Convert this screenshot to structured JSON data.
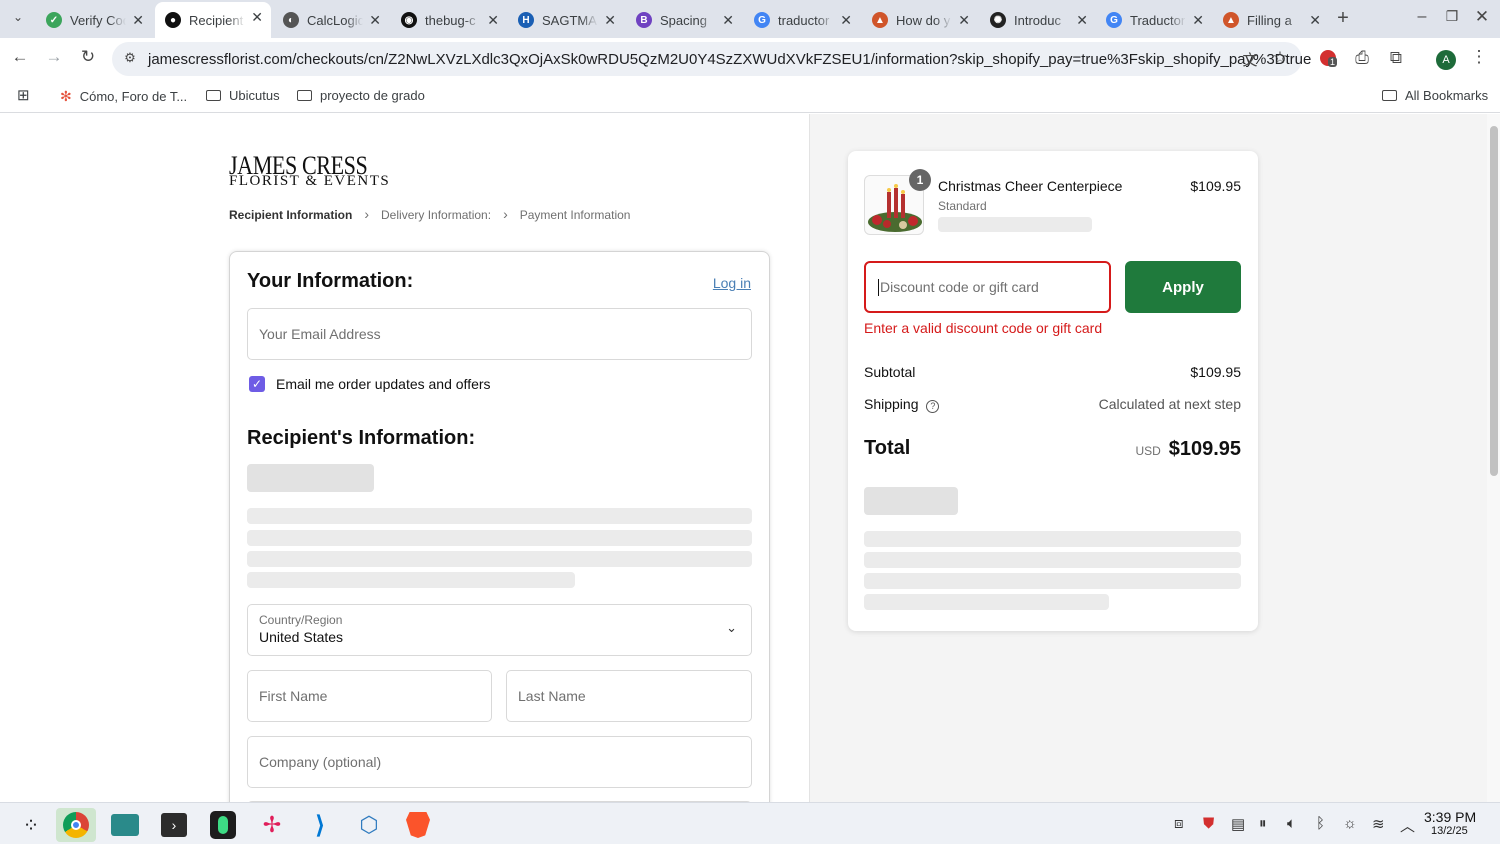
{
  "browser": {
    "tabs": [
      {
        "title": "Verify Code",
        "icon": "verify-icon",
        "color": "#3ca55c"
      },
      {
        "title": "Recipient Information",
        "icon": "shop-icon",
        "color": "#111111",
        "active": true
      },
      {
        "title": "CalcLogic",
        "icon": "calc-icon",
        "color": "#555555"
      },
      {
        "title": "thebug-c",
        "icon": "github-icon",
        "color": "#111111"
      },
      {
        "title": "SAGTMA",
        "icon": "h-icon",
        "color": "#1a5fb4"
      },
      {
        "title": "Spacing",
        "icon": "bootstrap-icon",
        "color": "#6f42c1"
      },
      {
        "title": "traductor",
        "icon": "google-icon",
        "color": "#4285f4"
      },
      {
        "title": "How do y",
        "icon": "page-icon",
        "color": "#d0552a"
      },
      {
        "title": "Introduc",
        "icon": "openai-icon",
        "color": "#222222"
      },
      {
        "title": "Traductor",
        "icon": "translate-icon",
        "color": "#4285f4"
      },
      {
        "title": "Filling a",
        "icon": "page-icon",
        "color": "#d0552a"
      }
    ],
    "url": "jamescressflorist.com/checkouts/cn/Z2NwLXVzLXdlc3QxOjAxSk0wRDU5QzM2U0Y4SzZXWUdXVkFZSEU1/information?skip_shopify_pay=true%3Fskip_shopify_pay%3Dtrue",
    "bookmarks": [
      "Cómo, Foro de T...",
      "Ubicutus",
      "proyecto de grado"
    ],
    "all_bookmarks": "All Bookmarks",
    "profile_initial": "A",
    "ext_badge": "1"
  },
  "brand": {
    "line1": "JAMES CRESS",
    "line2": "FLORIST & EVENTS"
  },
  "breadcrumb": {
    "step1": "Recipient Information",
    "step2": "Delivery Information:",
    "step3": "Payment Information",
    "sep": "›"
  },
  "form": {
    "your_info_heading": "Your Information:",
    "login_link": "Log in",
    "email_placeholder": "Your Email Address",
    "email_opt_in_label": "Email me order updates and offers",
    "recipient_heading": "Recipient's Information:",
    "country_label": "Country/Region",
    "country_value": "United States",
    "first_name_placeholder": "First Name",
    "last_name_placeholder": "Last Name",
    "company_placeholder": "Company (optional)"
  },
  "summary": {
    "product_name": "Christmas Cheer Centerpiece",
    "product_variant": "Standard",
    "product_price": "$109.95",
    "quantity": "1",
    "discount_placeholder": "Discount code or gift card",
    "apply_label": "Apply",
    "discount_error": "Enter a valid discount code or gift card",
    "subtotal_label": "Subtotal",
    "subtotal_value": "$109.95",
    "shipping_label": "Shipping",
    "shipping_value": "Calculated at next step",
    "total_label": "Total",
    "currency": "USD",
    "total_value": "$109.95"
  },
  "taskbar": {
    "time": "3:39 PM",
    "date": "13/2/25"
  },
  "colors": {
    "apply_green": "#1f7a3c",
    "error_red": "#d51a1a",
    "checkbox_purple": "#6e5ce5",
    "link_blue": "#4a7fb5"
  }
}
